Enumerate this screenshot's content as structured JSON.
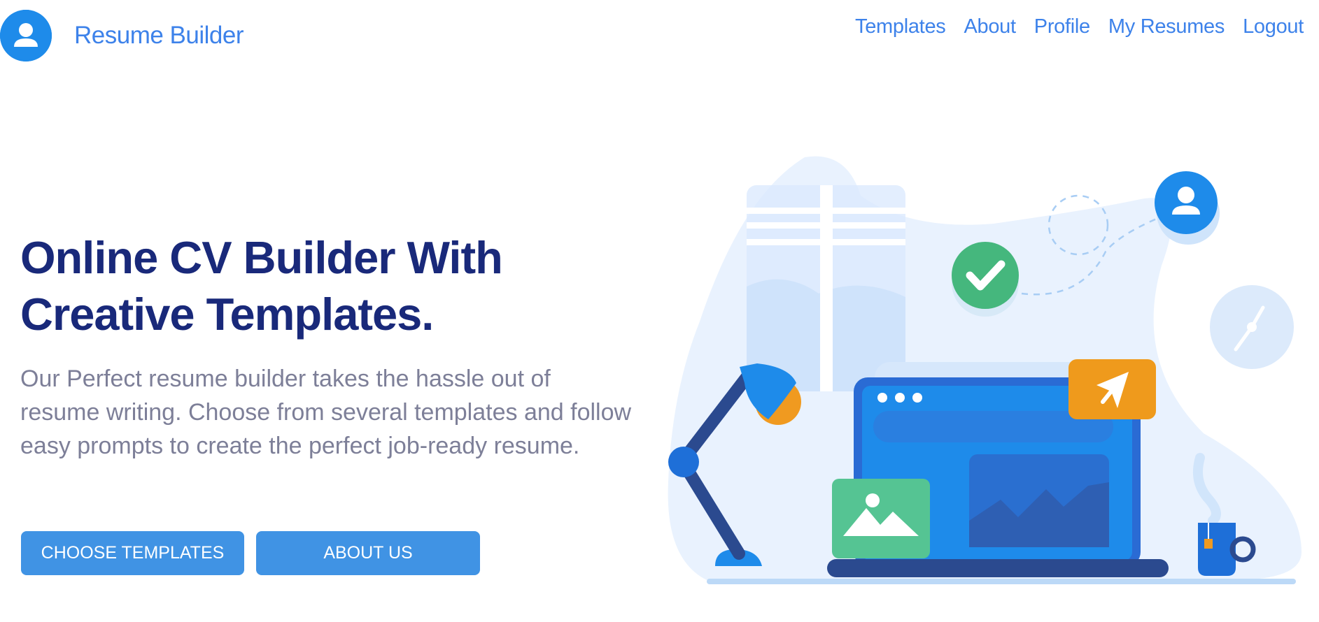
{
  "brand": {
    "name": "Resume Builder",
    "logo_icon": "user-avatar-icon"
  },
  "nav": {
    "items": [
      {
        "label": "Templates"
      },
      {
        "label": "About"
      },
      {
        "label": "Profile"
      },
      {
        "label": "My Resumes"
      },
      {
        "label": "Logout"
      }
    ]
  },
  "hero": {
    "title_line1": "Online CV Builder With",
    "title_line2": "Creative Templates.",
    "description": "Our Perfect resume builder takes the hassle out of resume writing. Choose from several templates and follow easy prompts to create the perfect job-ready resume.",
    "primary_button": "CHOOSE TEMPLATES",
    "secondary_button": "ABOUT US"
  },
  "colors": {
    "accent": "#3d82ea",
    "title": "#19297a",
    "body_text": "#7d7f98",
    "button": "#4093e4"
  }
}
